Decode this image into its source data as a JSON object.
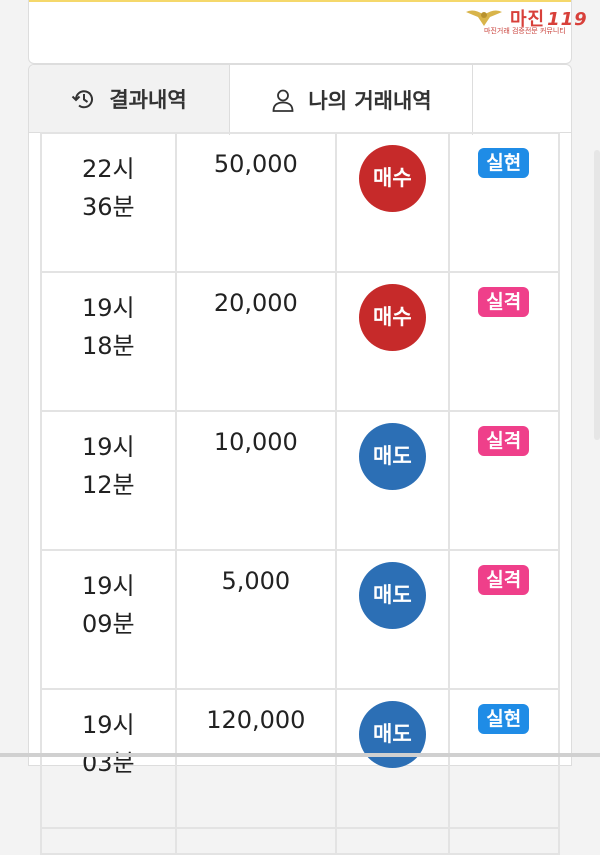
{
  "watermark": {
    "title": "마진",
    "title_suffix": "119",
    "subtitle": "마진거래 검증전문 커뮤니티"
  },
  "tabs": [
    {
      "label": "결과내역",
      "icon": "history-icon",
      "active": false
    },
    {
      "label": "나의 거래내역",
      "icon": "user-icon",
      "active": true
    }
  ],
  "trades": [
    {
      "hour": "22시",
      "minute": "36분",
      "amount": "50,000",
      "type": "매수",
      "result": "실현"
    },
    {
      "hour": "19시",
      "minute": "18분",
      "amount": "20,000",
      "type": "매수",
      "result": "실격"
    },
    {
      "hour": "19시",
      "minute": "12분",
      "amount": "10,000",
      "type": "매도",
      "result": "실격"
    },
    {
      "hour": "19시",
      "minute": "09분",
      "amount": "5,000",
      "type": "매도",
      "result": "실격"
    },
    {
      "hour": "19시",
      "minute": "03분",
      "amount": "120,000",
      "type": "매도",
      "result": "실현"
    }
  ],
  "colors": {
    "buy": "#c62a2a",
    "sell": "#2c6fb5",
    "win": "#1f8ce6",
    "lose": "#ef3f8a"
  }
}
